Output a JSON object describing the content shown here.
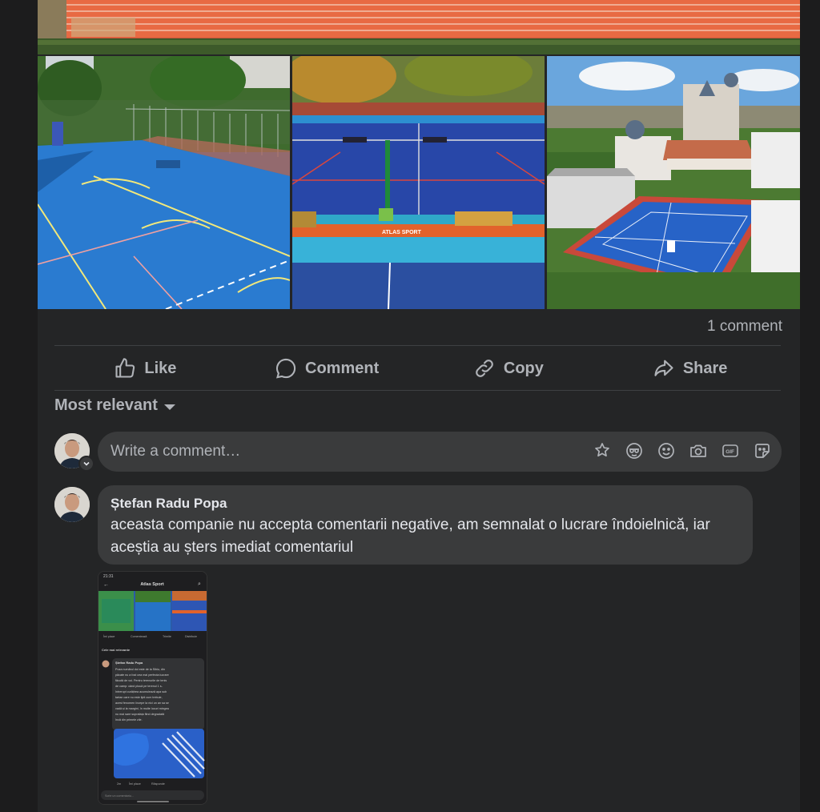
{
  "post": {
    "comment_count": "1 comment"
  },
  "actions": {
    "like": "Like",
    "comment": "Comment",
    "copy": "Copy",
    "share": "Share"
  },
  "sort": {
    "label": "Most relevant"
  },
  "composer": {
    "placeholder": "Write a comment…",
    "icons": [
      "sticker-icon",
      "avatar-sticker-icon",
      "emoji-icon",
      "camera-icon",
      "gif-icon",
      "sticker-face-icon"
    ]
  },
  "comment": {
    "author": "Ștefan Radu Popa",
    "text": "aceasta companie nu accepta comentarii negative, am semnalat o lucrare îndoielnică, iar aceștia au șters imediat comentariul",
    "attachment": {
      "page_name": "Atlas Sport",
      "status_time": "21:31",
      "actions": [
        "Îmi place",
        "Comentează",
        "Trimite",
        "Distribuie"
      ],
      "sort_label": "Cele mai relevante",
      "author": "Ștefan Radu Popa",
      "text_lines": [
        "Poza numărul doi este de la Sibiu, din",
        "păcate nu a fost cea mai perfecta lucrare",
        "făcută de voi. Pentru terenurile de tenis",
        "de camp: când plouă pe terenul 1 s-",
        "întrerupt curățirea acumulează apa sub",
        "tartan care nu este lipit cum trebuie,",
        "acest fenomen începe la nici un an sa se",
        "vadă și la margini, în multe locuri mingea",
        "nu mai sare suprafața fiind degradată",
        "încă din primele zile."
      ],
      "meta": [
        "2m",
        "Îmi place",
        "Răspunde"
      ],
      "reply_placeholder": "Scrie un comentariu..."
    }
  },
  "colors": {
    "background": "#242526",
    "page": "#1c1c1d",
    "bubble": "#3a3b3c",
    "text_primary": "#e4e6eb",
    "text_secondary": "#b0b3b8"
  }
}
